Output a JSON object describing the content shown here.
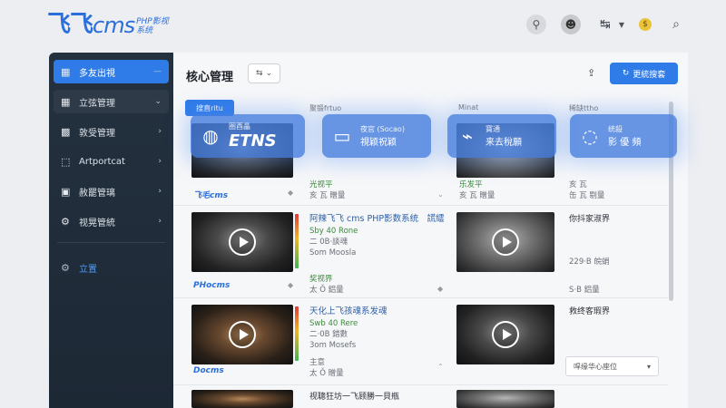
{
  "header": {
    "logo_main": "飞飞",
    "logo_cms": "cms",
    "logo_sub1": "PHP影视",
    "logo_sub2": "系统",
    "icons": [
      "user-search-icon",
      "avatar-icon",
      "language-icon",
      "coin-icon",
      "search-icon"
    ]
  },
  "sidebar": {
    "items": [
      {
        "label": "多友出視",
        "icon": "grid-icon"
      },
      {
        "label": "立弦管理",
        "icon": "apps-icon"
      },
      {
        "label": "敦受管理",
        "icon": "puzzle-icon"
      },
      {
        "label": "Artportcat",
        "icon": "box-icon"
      },
      {
        "label": "赦罷管璃",
        "icon": "film-icon"
      },
      {
        "label": "视晃管統",
        "icon": "gear-icon"
      }
    ],
    "settings_label": "立置"
  },
  "main": {
    "title": "核心管理",
    "filter_label": "⇆",
    "update_label": "更統搜套",
    "column_tag": "搜直ritu",
    "column_heads": [
      "聚锻frtuo",
      "Minat",
      "稀缺ttho"
    ],
    "select_label": "哻缘华心座位",
    "cards": [
      {
        "brand": "飞毛cms",
        "line1": "乐发平",
        "line2": "亥 瓦 贈量",
        "col2_line1": "光视平",
        "col2_line2": "亥 瓦 贈量",
        "col4_line1": "亥 瓦",
        "col4_line2": "缶 瓦 剔量"
      },
      {
        "brand": "PHocms",
        "title": "阿辣飞飞 cms PHP影数系统　謊繧",
        "sub1": "Sby 40 Rone",
        "sub2": "二 0B·談魂",
        "sub3": "Som Moosla",
        "line1": "奖视界",
        "line2": "太 Ǒ 鋁量",
        "col4_title": "你抖家淑界",
        "col4_sub": "229·B 皖蛸",
        "col4_line": "S·B 鋁量"
      },
      {
        "brand": "Docms",
        "title": "天化上飞孩魂系发魂",
        "sub1": "Swb 40 Rere",
        "sub2": "二·0B 錯數",
        "sub3": "3om Mosefs",
        "line1": "主意",
        "line2": "太 Ǒ 贈量",
        "col4_title": "救终客瑕界"
      },
      {
        "title": "视聰狂坊一飞顾勝一貝瓶"
      }
    ]
  },
  "chips": [
    {
      "line1": "圏酉瞐",
      "line2": "ETNS",
      "icon": "globe-icon"
    },
    {
      "line1": "夜官 (Socao)",
      "line2": "視颖祝颖",
      "icon": "monitor-icon"
    },
    {
      "line1": "寶通",
      "line2": "来去稅願",
      "icon": "satellite-icon"
    },
    {
      "line1": "统殺",
      "line2": "影 優 頻",
      "icon": "chat-icon"
    }
  ]
}
